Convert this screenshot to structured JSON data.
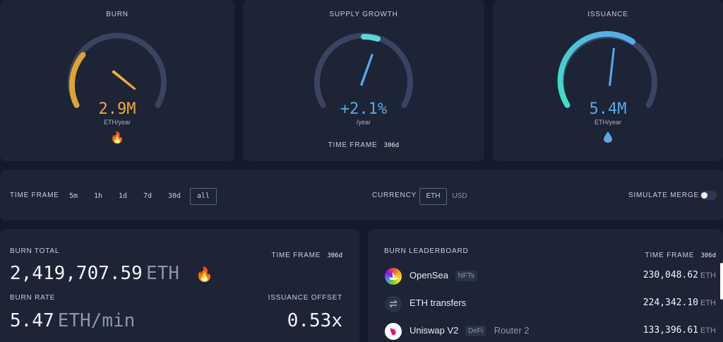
{
  "gauges": {
    "burn": {
      "title": "BURN",
      "value": "2.9M",
      "unit": "ETH/year",
      "emoji": "🔥",
      "value_color": "#f2a93b"
    },
    "supply": {
      "title": "SUPPLY GROWTH",
      "value": "+2.1%",
      "unit": "/year",
      "timeframe_label": "TIME FRAME",
      "timeframe_value": "306d",
      "value_color": "#5aa7e8"
    },
    "issuance": {
      "title": "ISSUANCE",
      "value": "5.4M",
      "unit": "ETH/year",
      "emoji": "💧",
      "value_color": "#5aa7e8"
    }
  },
  "timeframe_bar": {
    "label": "TIME FRAME",
    "options": [
      "5m",
      "1h",
      "1d",
      "7d",
      "30d",
      "all"
    ],
    "selected": "all",
    "currency_label": "CURRENCY",
    "currency_options": [
      "ETH",
      "USD"
    ],
    "currency_selected": "ETH",
    "simulate_merge_label": "SIMULATE MERGE",
    "simulate_merge_on": false
  },
  "burn_total": {
    "title": "BURN TOTAL",
    "timeframe_label": "TIME FRAME",
    "timeframe_value": "306d",
    "value": "2,419,707.59",
    "unit": "ETH",
    "emoji": "🔥",
    "burn_rate_label": "BURN RATE",
    "burn_rate_value": "5.47",
    "burn_rate_unit": "ETH/min",
    "issuance_offset_label": "ISSUANCE OFFSET",
    "issuance_offset_value": "0.53x"
  },
  "leaderboard": {
    "title": "BURN LEADERBOARD",
    "timeframe_label": "TIME FRAME",
    "timeframe_value": "306d",
    "rows": [
      {
        "name": "OpenSea",
        "tag": "NFTs",
        "detail": "",
        "value": "230,048.62",
        "unit": "ETH",
        "icon": "opensea-icon"
      },
      {
        "name": "ETH transfers",
        "tag": "",
        "detail": "",
        "value": "224,342.10",
        "unit": "ETH",
        "icon": "transfer-arrows-icon"
      },
      {
        "name": "Uniswap V2",
        "tag": "DeFi",
        "detail": "Router 2",
        "value": "133,396.61",
        "unit": "ETH",
        "icon": "uniswap-icon"
      }
    ]
  }
}
